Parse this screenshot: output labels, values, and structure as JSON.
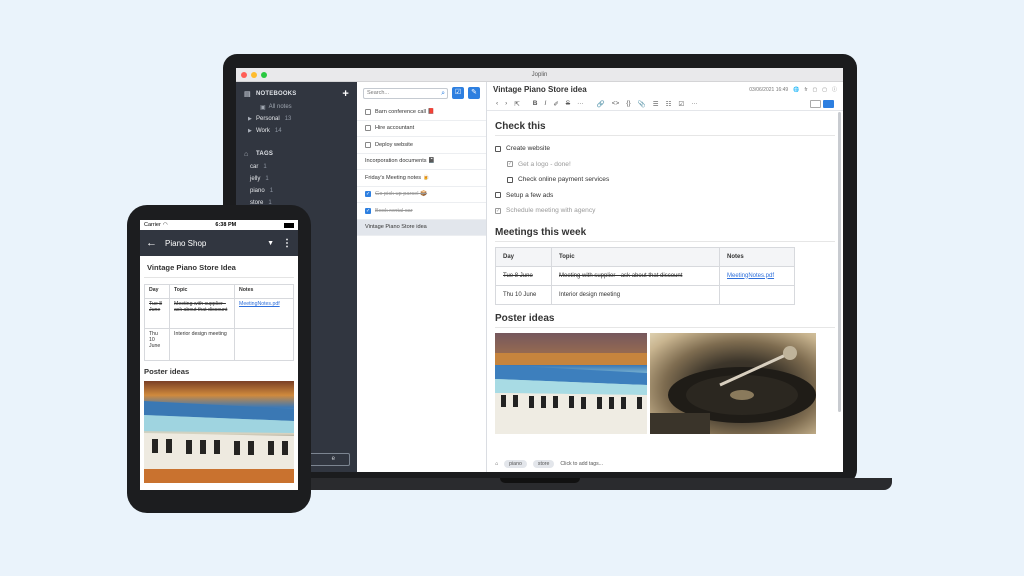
{
  "app": {
    "title": "Joplin"
  },
  "sidebar": {
    "notebooks_label": "NOTEBOOKS",
    "all_notes": "All notes",
    "notebooks": [
      {
        "label": "Personal",
        "count": "13"
      },
      {
        "label": "Work",
        "count": "14"
      }
    ],
    "tags_label": "TAGS",
    "tags": [
      {
        "label": "car",
        "count": "1"
      },
      {
        "label": "jelly",
        "count": "1"
      },
      {
        "label": "piano",
        "count": "1"
      },
      {
        "label": "store",
        "count": "1"
      }
    ],
    "sync_label": "e"
  },
  "notelist": {
    "search_placeholder": "Search...",
    "notes": [
      {
        "title": "Barn conference call 📕",
        "todo": true,
        "done": false
      },
      {
        "title": "Hire accountant",
        "todo": true,
        "done": false
      },
      {
        "title": "Deploy website",
        "todo": true,
        "done": false
      },
      {
        "title": "Incorporation documents 📓",
        "todo": false,
        "done": false
      },
      {
        "title": "Friday's Meeting notes 🍺",
        "todo": false,
        "done": false
      },
      {
        "title": "Go pick up parcel 📦",
        "todo": true,
        "done": true
      },
      {
        "title": "Book rental car",
        "todo": true,
        "done": true
      },
      {
        "title": "Vintage Piano Store idea",
        "todo": false,
        "done": false
      }
    ]
  },
  "editor": {
    "title": "Vintage Piano Store idea",
    "date": "03/06/2021 16:49",
    "lang": "fr",
    "h_check": "Check this",
    "todos": [
      {
        "label": "Create website",
        "done": false,
        "indent": false
      },
      {
        "label": "Get a logo - done!",
        "done": true,
        "indent": true
      },
      {
        "label": "Check online payment services",
        "done": false,
        "indent": true
      },
      {
        "label": "Setup a few ads",
        "done": false,
        "indent": false
      },
      {
        "label": "Schedule meeting with agency",
        "done": true,
        "indent": false
      }
    ],
    "h_meetings": "Meetings this week",
    "table": {
      "headers": [
        "Day",
        "Topic",
        "Notes"
      ],
      "rows": [
        {
          "day": "Tue 8 June",
          "topic": "Meeting with supplier - ask about that discount",
          "notes": "MeetingNotes.pdf",
          "struck": true
        },
        {
          "day": "Thu 10 June",
          "topic": "Interior design meeting",
          "notes": "",
          "struck": false
        }
      ]
    },
    "h_poster": "Poster ideas",
    "tags": [
      "piano",
      "store"
    ],
    "add_tags": "Click to add tags..."
  },
  "phone": {
    "carrier": "Carrier",
    "time": "6:38 PM",
    "notebook": "Piano Shop",
    "note_title": "Vintage Piano Store Idea",
    "table": {
      "headers": [
        "Day",
        "Topic",
        "Notes"
      ],
      "row1": {
        "day": "Tue 8 June",
        "topic": "Meeting with supplier - ask about that discount",
        "notes": "MeetingNotes.pdf"
      },
      "row2": {
        "day": "Thu 10 June",
        "topic": "Interior design meeting",
        "notes": ""
      }
    },
    "poster": "Poster ideas"
  },
  "colors": {
    "accent": "#2d7fe0",
    "sidebar": "#313640",
    "background": "#eaf3fb"
  }
}
